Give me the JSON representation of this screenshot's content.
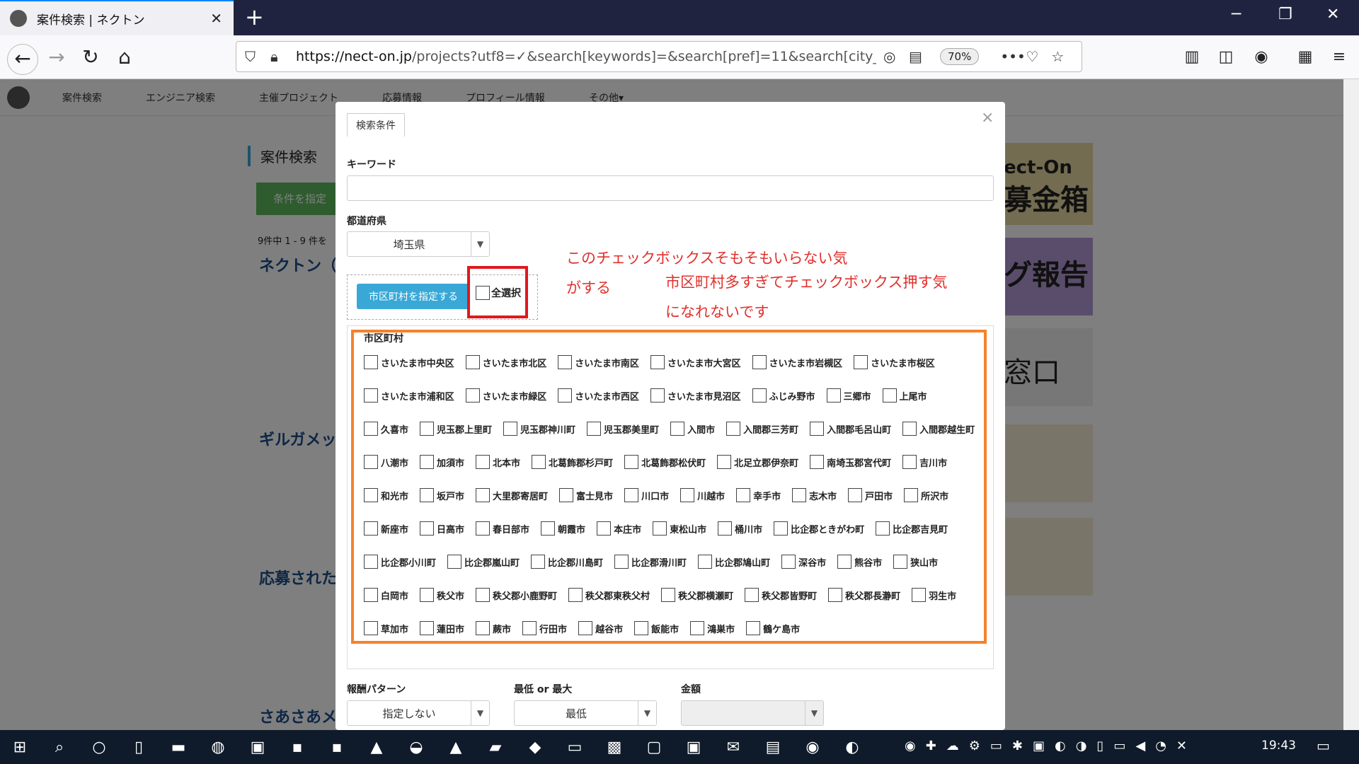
{
  "browser": {
    "tab_title": "案件検索 | ネクトン",
    "tab_close": "✕",
    "new_tab": "+",
    "url_host": "https://nect-on.jp",
    "url_rest": "/projects?utf8=✓&search[keywords]=&search[pref]=11&search[city_i",
    "zoom": "70%",
    "overflow": "•••"
  },
  "site": {
    "nav": [
      "案件検索",
      "エンジニア検索",
      "主催プロジェクト",
      "応募情報",
      "プロフィール情報",
      "その他▾"
    ],
    "page_title": "案件検索",
    "filter_button": "条件を指定",
    "result_count": "9件中 1 - 9 件を",
    "cards": [
      "ネクトン（",
      "ギルガメッ",
      "応募された",
      "さあさあメ"
    ],
    "ad_top": "ect-On",
    "ad_top2": "募金箱",
    "ad_mid": "グ報告",
    "ad_mid2": "窓口"
  },
  "modal": {
    "tab_label": "検索条件",
    "close": "×",
    "keyword_label": "キーワード",
    "keyword_value": "",
    "pref_label": "都道府県",
    "pref_value": "埼玉県",
    "city_button": "市区町村を指定する",
    "select_all": "全選択",
    "note1_line1": "このチェックボックスそもそもいらない気",
    "note1_line2": "がする",
    "note2_line1": "市区町村多すぎてチェックボックス押す気",
    "note2_line2": "になれないです",
    "city_label": "市区町村",
    "city_rows": [
      [
        "さいたま市中央区",
        "さいたま市北区",
        "さいたま市南区",
        "さいたま市大宮区",
        "さいたま市岩槻区",
        "さいたま市桜区"
      ],
      [
        "さいたま市浦和区",
        "さいたま市緑区",
        "さいたま市西区",
        "さいたま市見沼区",
        "ふじみ野市",
        "三郷市",
        "上尾市"
      ],
      [
        "久喜市",
        "児玉郡上里町",
        "児玉郡神川町",
        "児玉郡美里町",
        "入間市",
        "入間郡三芳町",
        "入間郡毛呂山町",
        "入間郡越生町"
      ],
      [
        "八潮市",
        "加須市",
        "北本市",
        "北葛飾郡杉戸町",
        "北葛飾郡松伏町",
        "北足立郡伊奈町",
        "南埼玉郡宮代町",
        "吉川市"
      ],
      [
        "和光市",
        "坂戸市",
        "大里郡寄居町",
        "富士見市",
        "川口市",
        "川越市",
        "幸手市",
        "志木市",
        "戸田市",
        "所沢市"
      ],
      [
        "新座市",
        "日高市",
        "春日部市",
        "朝霞市",
        "本庄市",
        "東松山市",
        "桶川市",
        "比企郡ときがわ町",
        "比企郡吉見町"
      ],
      [
        "比企郡小川町",
        "比企郡嵐山町",
        "比企郡川島町",
        "比企郡滑川町",
        "比企郡鳩山町",
        "深谷市",
        "熊谷市",
        "狭山市"
      ],
      [
        "白岡市",
        "秩父市",
        "秩父郡小鹿野町",
        "秩父郡東秩父村",
        "秩父郡横瀬町",
        "秩父郡皆野町",
        "秩父郡長瀞町",
        "羽生市"
      ],
      [
        "草加市",
        "蓮田市",
        "蕨市",
        "行田市",
        "越谷市",
        "飯能市",
        "鴻巣市",
        "鶴ケ島市"
      ]
    ],
    "reward_label": "報酬パターン",
    "reward_value": "指定しない",
    "minmax_label": "最低 or 最大",
    "minmax_value": "最低",
    "amount_label": "金額",
    "amount_value": ""
  },
  "taskbar": {
    "clock": "19:43"
  },
  "colors": {
    "accent": "#39a8d6",
    "annotation_red": "#e0302c",
    "annotation_orange": "#f5822a"
  }
}
